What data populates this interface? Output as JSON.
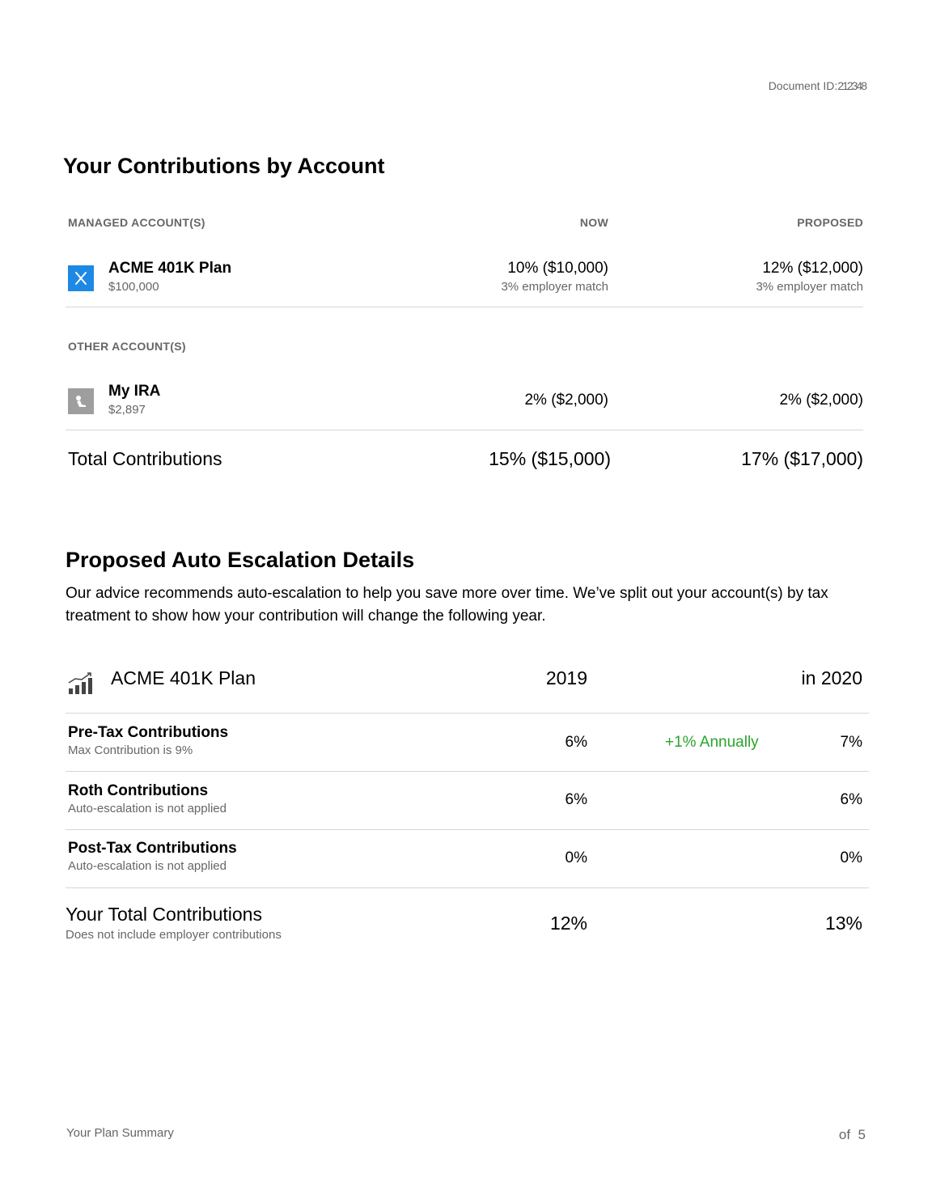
{
  "header": {
    "document_id_label": "Document ID:",
    "document_id_value": "212348"
  },
  "contributions": {
    "title": "Your Contributions by Account",
    "columns": {
      "managed": "MANAGED ACCOUNT(S)",
      "now": "NOW",
      "proposed": "PROPOSED"
    },
    "managed_accounts": [
      {
        "name": "ACME 401K Plan",
        "balance": "$100,000",
        "now": "10% ($10,000)",
        "now_sub": "3% employer match",
        "proposed": "12% ($12,000)",
        "proposed_sub": "3% employer match",
        "icon": "x-logo-icon",
        "icon_color": "#1e88e5"
      }
    ],
    "other_label": "OTHER ACCOUNT(S)",
    "other_accounts": [
      {
        "name": "My IRA",
        "balance": "$2,897",
        "now": "2% ($2,000)",
        "proposed": "2% ($2,000)",
        "icon": "ira-icon",
        "icon_color": "#9e9e9e"
      }
    ],
    "total": {
      "label": "Total Contributions",
      "now": "15% ($15,000)",
      "proposed": "17% ($17,000)"
    }
  },
  "escalation": {
    "title": "Proposed Auto Escalation Details",
    "intro": "Our advice recommends auto-escalation to help you save more over time. We’ve split out your account(s) by tax treatment to show how your contribution will change the following year.",
    "plan_name": "ACME 401K Plan",
    "year_now": "2019",
    "year_next": "in 2020",
    "rows": [
      {
        "name": "Pre-Tax Contributions",
        "note": "Max Contribution is 9%",
        "now": "6%",
        "change": "+1% Annually",
        "next": "7%"
      },
      {
        "name": "Roth Contributions",
        "note": "Auto-escalation is not applied",
        "now": "6%",
        "change": "",
        "next": "6%"
      },
      {
        "name": "Post-Tax Contributions",
        "note": "Auto-escalation is not applied",
        "now": "0%",
        "change": "",
        "next": "0%"
      }
    ],
    "total": {
      "label": "Your Total Contributions",
      "note": "Does not include employer contributions",
      "now": "12%",
      "next": "13%"
    },
    "accent_green": "#2aa52a"
  },
  "footer": {
    "title": "Your Plan Summary",
    "page": "of  5"
  }
}
